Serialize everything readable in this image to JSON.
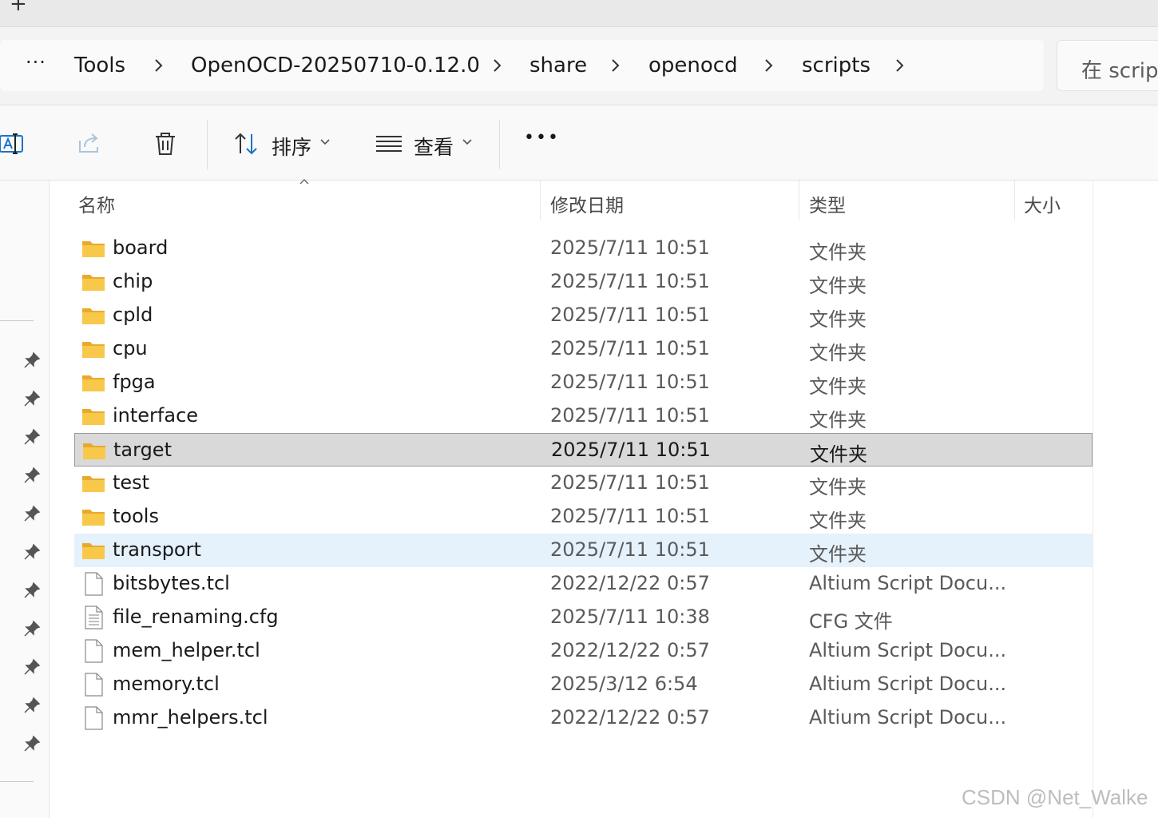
{
  "tabstrip": {
    "new_tab": "+"
  },
  "breadcrumb": {
    "more": "···",
    "items": [
      "Tools",
      "OpenOCD-20250710-0.12.0",
      "share",
      "openocd",
      "scripts"
    ]
  },
  "search": {
    "placeholder": "在 scripts 中搜索",
    "shown": "在 script"
  },
  "toolbar": {
    "sort_label": "排序",
    "view_label": "查看",
    "more": "•••"
  },
  "columns": {
    "name": "名称",
    "date": "修改日期",
    "type": "类型",
    "size": "大小"
  },
  "files": [
    {
      "name": "board",
      "date": "2025/7/11 10:51",
      "type": "文件夹",
      "icon": "folder-icon"
    },
    {
      "name": "chip",
      "date": "2025/7/11 10:51",
      "type": "文件夹",
      "icon": "folder-icon"
    },
    {
      "name": "cpld",
      "date": "2025/7/11 10:51",
      "type": "文件夹",
      "icon": "folder-icon"
    },
    {
      "name": "cpu",
      "date": "2025/7/11 10:51",
      "type": "文件夹",
      "icon": "folder-icon"
    },
    {
      "name": "fpga",
      "date": "2025/7/11 10:51",
      "type": "文件夹",
      "icon": "folder-icon"
    },
    {
      "name": "interface",
      "date": "2025/7/11 10:51",
      "type": "文件夹",
      "icon": "folder-icon"
    },
    {
      "name": "target",
      "date": "2025/7/11 10:51",
      "type": "文件夹",
      "icon": "folder-icon"
    },
    {
      "name": "test",
      "date": "2025/7/11 10:51",
      "type": "文件夹",
      "icon": "folder-icon"
    },
    {
      "name": "tools",
      "date": "2025/7/11 10:51",
      "type": "文件夹",
      "icon": "folder-icon"
    },
    {
      "name": "transport",
      "date": "2025/7/11 10:51",
      "type": "文件夹",
      "icon": "folder-icon"
    },
    {
      "name": "bitsbytes.tcl",
      "date": "2022/12/22 0:57",
      "type": "Altium Script Docu...",
      "icon": "file-icon"
    },
    {
      "name": "file_renaming.cfg",
      "date": "2025/7/11 10:38",
      "type": "CFG 文件",
      "icon": "text-file-icon"
    },
    {
      "name": "mem_helper.tcl",
      "date": "2022/12/22 0:57",
      "type": "Altium Script Docu...",
      "icon": "file-icon"
    },
    {
      "name": "memory.tcl",
      "date": "2025/3/12 6:54",
      "type": "Altium Script Docu...",
      "icon": "file-icon"
    },
    {
      "name": "mmr_helpers.tcl",
      "date": "2022/12/22 0:57",
      "type": "Altium Script Docu...",
      "icon": "file-icon"
    }
  ],
  "selected_index": 6,
  "hover_index": 9,
  "colors": {
    "selected": "#d9d9d9",
    "hover": "#e5f1fb",
    "folder": "#f8c84a",
    "accent": "#1a73c9"
  },
  "watermark": "CSDN @Net_Walke"
}
